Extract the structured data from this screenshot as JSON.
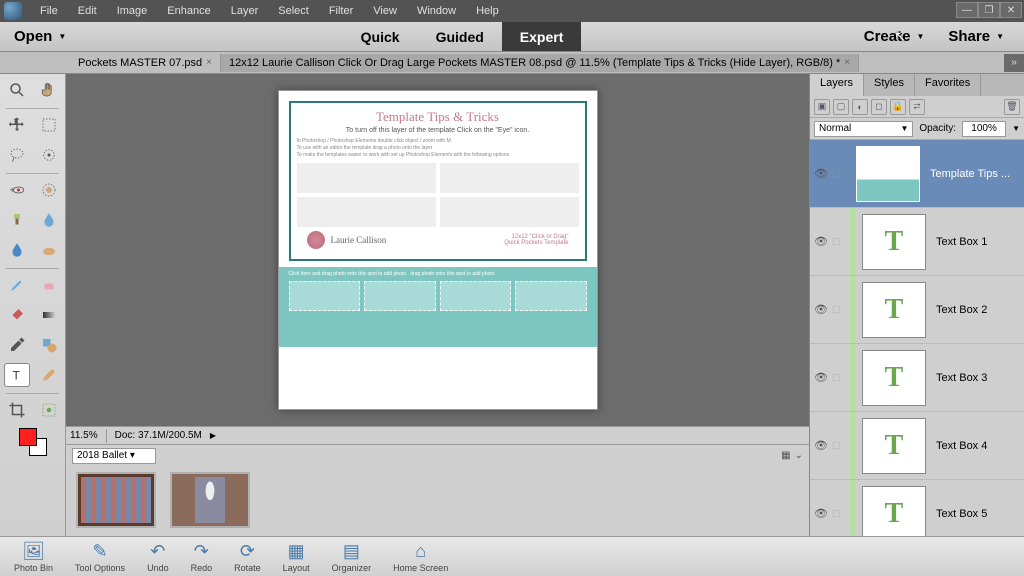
{
  "menu": [
    "File",
    "Edit",
    "Image",
    "Enhance",
    "Layer",
    "Select",
    "Filter",
    "View",
    "Window",
    "Help"
  ],
  "topbar": {
    "open": "Open",
    "create": "Create",
    "share": "Share"
  },
  "workspace_tabs": {
    "quick": "Quick",
    "guided": "Guided",
    "expert": "Expert",
    "active": "Expert"
  },
  "doc_tabs": {
    "tab1": "Pockets MASTER 07.psd",
    "tab2": "12x12 Laurie Callison Click Or Drag Large Pockets MASTER 08.psd @ 11.5% (Template Tips & Tricks (Hide Layer), RGB/8) *"
  },
  "status": {
    "zoom": "11.5%",
    "doc": "Doc: 37.1M/200.5M"
  },
  "bin": {
    "folder": "2018 Ballet"
  },
  "panels": {
    "tabs": {
      "layers": "Layers",
      "styles": "Styles",
      "favorites": "Favorites"
    },
    "blend_mode": "Normal",
    "opacity_label": "Opacity:",
    "opacity_value": "100%"
  },
  "layers": {
    "l0": "Template Tips ...",
    "l1": "Text Box 1",
    "l2": "Text Box 2",
    "l3": "Text Box 3",
    "l4": "Text Box 4",
    "l5": "Text Box 5"
  },
  "doc_content": {
    "title": "Template Tips & Tricks",
    "sub": "To turn off this layer of the template Click on the \"Eye\" icon.",
    "logo": "Laurie Callison"
  },
  "taskbar": {
    "photobin": "Photo Bin",
    "toolopts": "Tool Options",
    "undo": "Undo",
    "redo": "Redo",
    "rotate": "Rotate",
    "layout": "Layout",
    "organizer": "Organizer",
    "home": "Home Screen"
  }
}
